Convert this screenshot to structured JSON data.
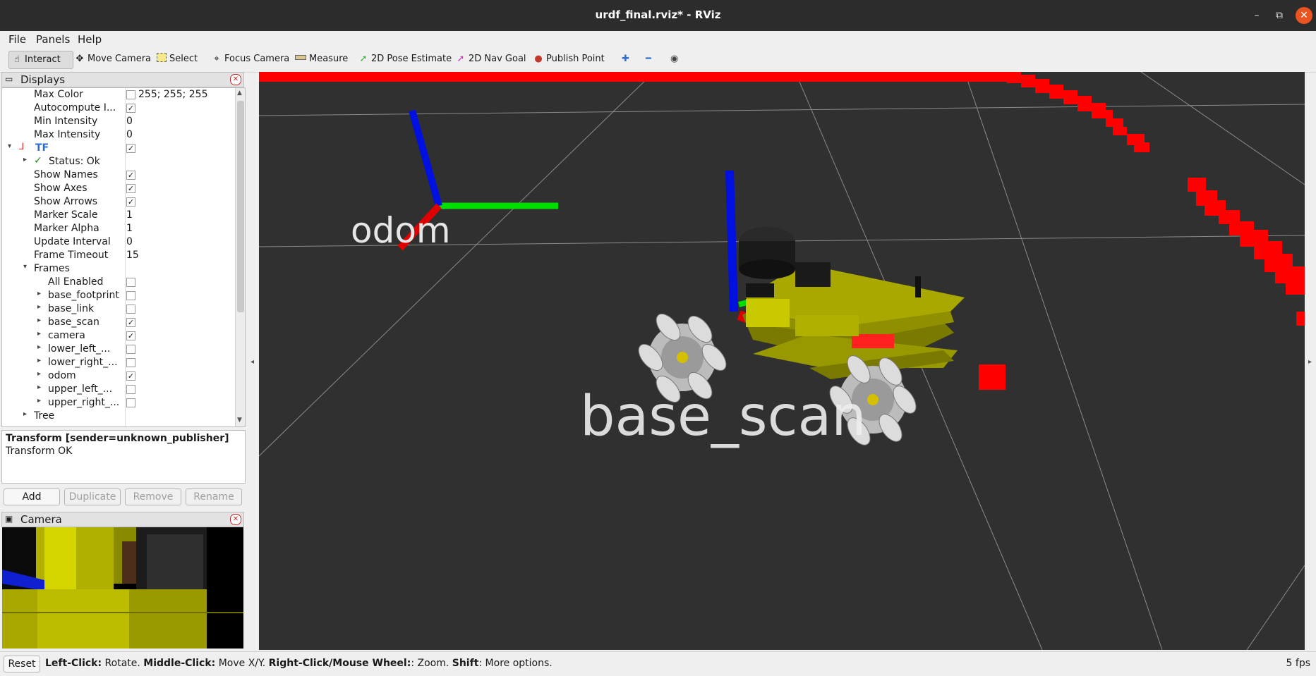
{
  "window": {
    "title": "urdf_final.rviz* - RViz",
    "controls": [
      "–",
      "⧉",
      "✕"
    ]
  },
  "menu": [
    "File",
    "Panels",
    "Help"
  ],
  "toolbar": {
    "tools": [
      "Interact",
      "Move Camera",
      "Select",
      "Focus Camera",
      "Measure",
      "2D Pose Estimate",
      "2D Nav Goal",
      "Publish Point"
    ],
    "active": "Interact"
  },
  "displays": {
    "title": "Displays",
    "rows": [
      {
        "name": "Max Color",
        "value": "255; 255; 255"
      },
      {
        "name": "Autocompute I...",
        "checked": true
      },
      {
        "name": "Min Intensity",
        "value": "0"
      },
      {
        "name": "Max Intensity",
        "value": "0"
      },
      {
        "name": "TF",
        "checked": true
      },
      {
        "name": "Status: Ok"
      },
      {
        "name": "Show Names",
        "checked": true
      },
      {
        "name": "Show Axes",
        "checked": true
      },
      {
        "name": "Show Arrows",
        "checked": true
      },
      {
        "name": "Marker Scale",
        "value": "1"
      },
      {
        "name": "Marker Alpha",
        "value": "1"
      },
      {
        "name": "Update Interval",
        "value": "0"
      },
      {
        "name": "Frame Timeout",
        "value": "15"
      },
      {
        "name": "Frames"
      },
      {
        "name": "All Enabled",
        "checked": false
      },
      {
        "name": "base_footprint",
        "checked": false
      },
      {
        "name": "base_link",
        "checked": false
      },
      {
        "name": "base_scan",
        "checked": true
      },
      {
        "name": "camera",
        "checked": true
      },
      {
        "name": "lower_left_...",
        "checked": false
      },
      {
        "name": "lower_right_...",
        "checked": false
      },
      {
        "name": "odom",
        "checked": true
      },
      {
        "name": "upper_left_...",
        "checked": false
      },
      {
        "name": "upper_right_...",
        "checked": false
      },
      {
        "name": "Tree"
      }
    ]
  },
  "status": {
    "heading": "Transform [sender=unknown_publisher]",
    "message": "Transform OK"
  },
  "buttons": {
    "add": "Add",
    "duplicate": "Duplicate",
    "remove": "Remove",
    "rename": "Rename"
  },
  "camera_panel": {
    "title": "Camera"
  },
  "viewport": {
    "labels": {
      "odom": "odom",
      "base": "base_scan"
    },
    "colors": {
      "background": "#303030",
      "scan": "#ff0000",
      "chassis": "#a8a800",
      "x_axis": "#e00000",
      "y_axis": "#00dd00",
      "z_axis": "#0010e0"
    }
  },
  "statusbar": {
    "reset": "Reset",
    "hint_parts": [
      {
        "text": "Left-Click:",
        "bold": true
      },
      {
        "text": " Rotate. ",
        "bold": false
      },
      {
        "text": "Middle-Click:",
        "bold": true
      },
      {
        "text": " Move X/Y. ",
        "bold": false
      },
      {
        "text": "Right-Click/Mouse Wheel:",
        "bold": true
      },
      {
        "text": ": Zoom. ",
        "bold": false
      },
      {
        "text": "Shift",
        "bold": true
      },
      {
        "text": ": More options.",
        "bold": false
      }
    ],
    "fps": "5 fps"
  }
}
